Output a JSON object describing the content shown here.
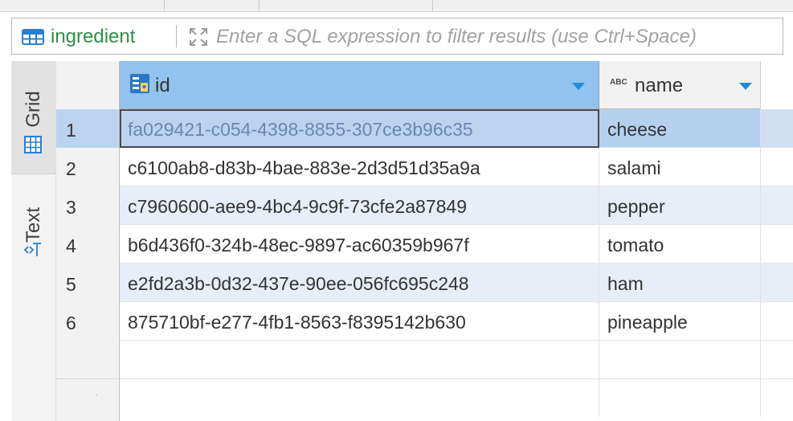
{
  "filter": {
    "entity": "ingredient",
    "placeholder": "Enter a SQL expression to filter results (use Ctrl+Space)",
    "value": ""
  },
  "sidebar": {
    "tabs": [
      {
        "label": "Grid",
        "icon": "grid-icon",
        "active": true
      },
      {
        "label": "Text",
        "icon": "text-icon",
        "active": false
      }
    ]
  },
  "grid": {
    "columns": [
      {
        "label": "id",
        "type_icon": "key-column-icon"
      },
      {
        "label": "name",
        "type_icon": "string-type-icon",
        "type_text": "ABC"
      }
    ],
    "rows": [
      {
        "num": "1",
        "id": "fa029421-c054-4398-8855-307ce3b96c35",
        "name": "cheese"
      },
      {
        "num": "2",
        "id": "c6100ab8-d83b-4bae-883e-2d3d51d35a9a",
        "name": "salami"
      },
      {
        "num": "3",
        "id": "c7960600-aee9-4bc4-9c9f-73cfe2a87849",
        "name": "pepper"
      },
      {
        "num": "4",
        "id": "b6d436f0-324b-48ec-9897-ac60359b967f",
        "name": "tomato"
      },
      {
        "num": "5",
        "id": "e2fd2a3b-0d32-437e-90ee-056fc695c248",
        "name": "ham"
      },
      {
        "num": "6",
        "id": "875710bf-e277-4fb1-8563-f8395142b630",
        "name": "pineapple"
      }
    ],
    "empty_row_marker": "·",
    "selected_row": 1
  },
  "colors": {
    "header_selected": "#91c3ee",
    "selection": "#bcd3f0",
    "entity_text": "#2f8f45",
    "accent_arrow": "#1f8fd6"
  }
}
